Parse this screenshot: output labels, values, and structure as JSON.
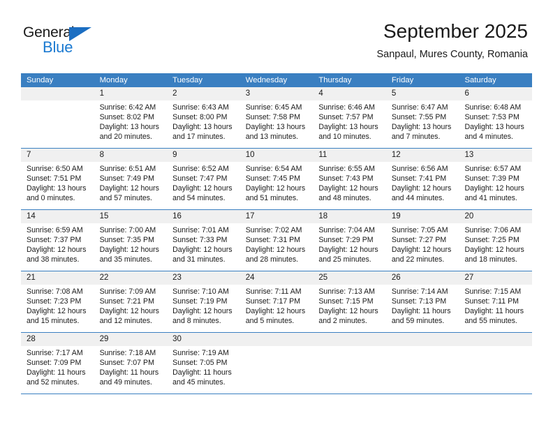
{
  "brand": {
    "name_top": "General",
    "name_bottom": "Blue",
    "triangle_icon": "triangle-icon",
    "accent_color": "#1b7ad1"
  },
  "header": {
    "title": "September 2025",
    "subtitle": "Sanpaul, Mures County, Romania"
  },
  "calendar": {
    "header_bg": "#3a7fc1",
    "daynum_bg": "#f0f0f0",
    "weekday_headers": [
      "Sunday",
      "Monday",
      "Tuesday",
      "Wednesday",
      "Thursday",
      "Friday",
      "Saturday"
    ],
    "weeks": [
      [
        {
          "day": "",
          "lines": []
        },
        {
          "day": "1",
          "lines": [
            "Sunrise: 6:42 AM",
            "Sunset: 8:02 PM",
            "Daylight: 13 hours",
            "and 20 minutes."
          ]
        },
        {
          "day": "2",
          "lines": [
            "Sunrise: 6:43 AM",
            "Sunset: 8:00 PM",
            "Daylight: 13 hours",
            "and 17 minutes."
          ]
        },
        {
          "day": "3",
          "lines": [
            "Sunrise: 6:45 AM",
            "Sunset: 7:58 PM",
            "Daylight: 13 hours",
            "and 13 minutes."
          ]
        },
        {
          "day": "4",
          "lines": [
            "Sunrise: 6:46 AM",
            "Sunset: 7:57 PM",
            "Daylight: 13 hours",
            "and 10 minutes."
          ]
        },
        {
          "day": "5",
          "lines": [
            "Sunrise: 6:47 AM",
            "Sunset: 7:55 PM",
            "Daylight: 13 hours",
            "and 7 minutes."
          ]
        },
        {
          "day": "6",
          "lines": [
            "Sunrise: 6:48 AM",
            "Sunset: 7:53 PM",
            "Daylight: 13 hours",
            "and 4 minutes."
          ]
        }
      ],
      [
        {
          "day": "7",
          "lines": [
            "Sunrise: 6:50 AM",
            "Sunset: 7:51 PM",
            "Daylight: 13 hours",
            "and 0 minutes."
          ]
        },
        {
          "day": "8",
          "lines": [
            "Sunrise: 6:51 AM",
            "Sunset: 7:49 PM",
            "Daylight: 12 hours",
            "and 57 minutes."
          ]
        },
        {
          "day": "9",
          "lines": [
            "Sunrise: 6:52 AM",
            "Sunset: 7:47 PM",
            "Daylight: 12 hours",
            "and 54 minutes."
          ]
        },
        {
          "day": "10",
          "lines": [
            "Sunrise: 6:54 AM",
            "Sunset: 7:45 PM",
            "Daylight: 12 hours",
            "and 51 minutes."
          ]
        },
        {
          "day": "11",
          "lines": [
            "Sunrise: 6:55 AM",
            "Sunset: 7:43 PM",
            "Daylight: 12 hours",
            "and 48 minutes."
          ]
        },
        {
          "day": "12",
          "lines": [
            "Sunrise: 6:56 AM",
            "Sunset: 7:41 PM",
            "Daylight: 12 hours",
            "and 44 minutes."
          ]
        },
        {
          "day": "13",
          "lines": [
            "Sunrise: 6:57 AM",
            "Sunset: 7:39 PM",
            "Daylight: 12 hours",
            "and 41 minutes."
          ]
        }
      ],
      [
        {
          "day": "14",
          "lines": [
            "Sunrise: 6:59 AM",
            "Sunset: 7:37 PM",
            "Daylight: 12 hours",
            "and 38 minutes."
          ]
        },
        {
          "day": "15",
          "lines": [
            "Sunrise: 7:00 AM",
            "Sunset: 7:35 PM",
            "Daylight: 12 hours",
            "and 35 minutes."
          ]
        },
        {
          "day": "16",
          "lines": [
            "Sunrise: 7:01 AM",
            "Sunset: 7:33 PM",
            "Daylight: 12 hours",
            "and 31 minutes."
          ]
        },
        {
          "day": "17",
          "lines": [
            "Sunrise: 7:02 AM",
            "Sunset: 7:31 PM",
            "Daylight: 12 hours",
            "and 28 minutes."
          ]
        },
        {
          "day": "18",
          "lines": [
            "Sunrise: 7:04 AM",
            "Sunset: 7:29 PM",
            "Daylight: 12 hours",
            "and 25 minutes."
          ]
        },
        {
          "day": "19",
          "lines": [
            "Sunrise: 7:05 AM",
            "Sunset: 7:27 PM",
            "Daylight: 12 hours",
            "and 22 minutes."
          ]
        },
        {
          "day": "20",
          "lines": [
            "Sunrise: 7:06 AM",
            "Sunset: 7:25 PM",
            "Daylight: 12 hours",
            "and 18 minutes."
          ]
        }
      ],
      [
        {
          "day": "21",
          "lines": [
            "Sunrise: 7:08 AM",
            "Sunset: 7:23 PM",
            "Daylight: 12 hours",
            "and 15 minutes."
          ]
        },
        {
          "day": "22",
          "lines": [
            "Sunrise: 7:09 AM",
            "Sunset: 7:21 PM",
            "Daylight: 12 hours",
            "and 12 minutes."
          ]
        },
        {
          "day": "23",
          "lines": [
            "Sunrise: 7:10 AM",
            "Sunset: 7:19 PM",
            "Daylight: 12 hours",
            "and 8 minutes."
          ]
        },
        {
          "day": "24",
          "lines": [
            "Sunrise: 7:11 AM",
            "Sunset: 7:17 PM",
            "Daylight: 12 hours",
            "and 5 minutes."
          ]
        },
        {
          "day": "25",
          "lines": [
            "Sunrise: 7:13 AM",
            "Sunset: 7:15 PM",
            "Daylight: 12 hours",
            "and 2 minutes."
          ]
        },
        {
          "day": "26",
          "lines": [
            "Sunrise: 7:14 AM",
            "Sunset: 7:13 PM",
            "Daylight: 11 hours",
            "and 59 minutes."
          ]
        },
        {
          "day": "27",
          "lines": [
            "Sunrise: 7:15 AM",
            "Sunset: 7:11 PM",
            "Daylight: 11 hours",
            "and 55 minutes."
          ]
        }
      ],
      [
        {
          "day": "28",
          "lines": [
            "Sunrise: 7:17 AM",
            "Sunset: 7:09 PM",
            "Daylight: 11 hours",
            "and 52 minutes."
          ]
        },
        {
          "day": "29",
          "lines": [
            "Sunrise: 7:18 AM",
            "Sunset: 7:07 PM",
            "Daylight: 11 hours",
            "and 49 minutes."
          ]
        },
        {
          "day": "30",
          "lines": [
            "Sunrise: 7:19 AM",
            "Sunset: 7:05 PM",
            "Daylight: 11 hours",
            "and 45 minutes."
          ]
        },
        {
          "day": "",
          "lines": []
        },
        {
          "day": "",
          "lines": []
        },
        {
          "day": "",
          "lines": []
        },
        {
          "day": "",
          "lines": []
        }
      ]
    ]
  }
}
